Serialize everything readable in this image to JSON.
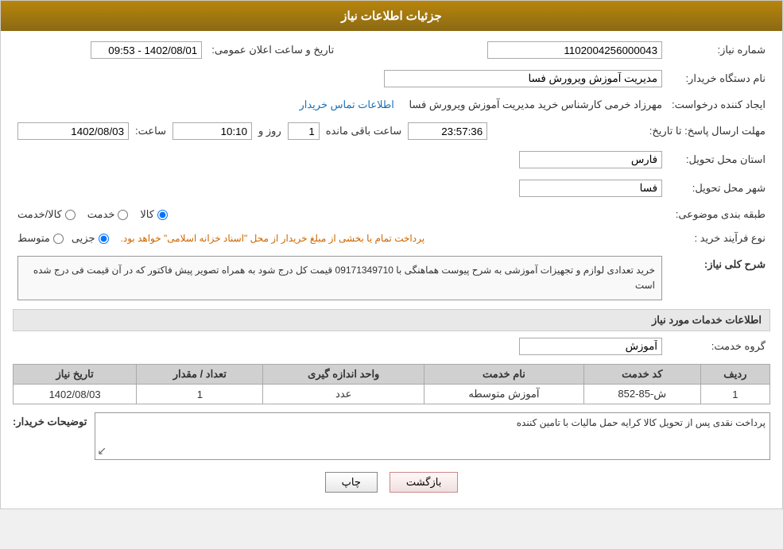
{
  "header": {
    "title": "جزئیات اطلاعات نیاز"
  },
  "fields": {
    "need_number_label": "شماره نیاز:",
    "need_number_value": "1102004256000043",
    "org_name_label": "نام دستگاه خریدار:",
    "org_name_value": "مدیریت آموزش ویرورش فسا",
    "creator_label": "ایجاد کننده درخواست:",
    "creator_value": "مهرزاد خرمی کارشناس خرید مدیریت آموزش ویرورش فسا",
    "contact_link": "اطلاعات تماس خریدار",
    "deadline_label": "مهلت ارسال پاسخ: تا تاریخ:",
    "deadline_date": "1402/08/03",
    "deadline_time_label": "ساعت:",
    "deadline_time": "10:10",
    "deadline_days_label": "روز و",
    "deadline_days": "1",
    "deadline_remaining_label": "ساعت باقی مانده",
    "deadline_remaining": "23:57:36",
    "province_label": "استان محل تحویل:",
    "province_value": "فارس",
    "city_label": "شهر محل تحویل:",
    "city_value": "فسا",
    "category_label": "طبقه بندی موضوعی:",
    "category_kala": "کالا",
    "category_khadamat": "خدمت",
    "category_kala_khadamat": "کالا/خدمت",
    "process_label": "نوع فرآیند خرید :",
    "process_jazee": "جزیی",
    "process_motavasset": "متوسط",
    "process_note": "پرداخت تمام یا بخشی از مبلغ خریدار از محل \"اسناد خزانه اسلامی\" خواهد بود.",
    "announce_date_label": "تاریخ و ساعت اعلان عمومی:",
    "announce_date_value": "1402/08/01 - 09:53",
    "description_label": "شرح کلی نیاز:",
    "description_text": "خرید تعدادی لوازم و تجهیزات آموزشی به شرح پیوست هماهنگی با 09171349710 قیمت کل درج شود به همراه تصویر پیش فاکتور که در آن قیمت فی درج شده است",
    "services_label": "اطلاعات خدمات مورد نیاز",
    "service_group_label": "گروه خدمت:",
    "service_group_value": "آموزش",
    "table_headers": {
      "row_num": "ردیف",
      "service_code": "کد خدمت",
      "service_name": "نام خدمت",
      "unit": "واحد اندازه گیری",
      "quantity": "تعداد / مقدار",
      "date": "تاریخ نیاز"
    },
    "table_rows": [
      {
        "row_num": "1",
        "service_code": "ش-85-852",
        "service_name": "آموزش متوسطه",
        "unit": "عدد",
        "quantity": "1",
        "date": "1402/08/03"
      }
    ],
    "buyer_notes_label": "توضیحات خریدار:",
    "buyer_notes_value": "پرداخت نقدی پس از تحویل کالا کرایه حمل مالیات با تامین کننده"
  },
  "buttons": {
    "print_label": "چاپ",
    "back_label": "بازگشت"
  }
}
